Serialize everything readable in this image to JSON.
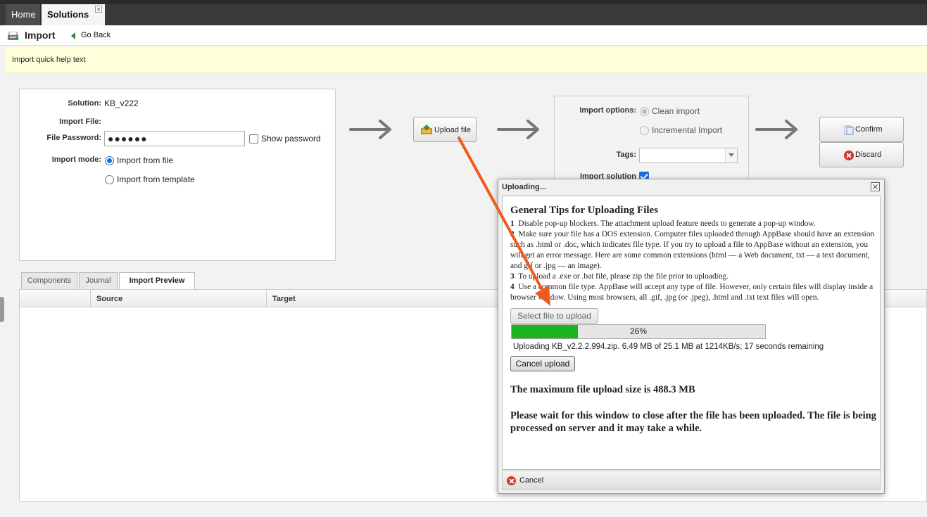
{
  "tabs": [
    {
      "label": "Home"
    },
    {
      "label": "Solutions"
    }
  ],
  "toolbar": {
    "title": "Import",
    "go_back_label": "Go Back"
  },
  "help_text": "Import quick help text",
  "form": {
    "solution_label": "Solution:",
    "solution_value": "KB_v222",
    "import_file_label": "Import File:",
    "file_password_label": "File Password:",
    "file_password_value": "●●●●●●",
    "show_password_label": "Show password",
    "import_mode_label": "Import mode:",
    "mode_file_label": "Import from file",
    "mode_template_label": "Import from template"
  },
  "upload_button_label": "Upload file",
  "options": {
    "import_options_label": "Import options:",
    "clean_import_label": "Clean import",
    "incremental_import_label": "Incremental Import",
    "tags_label": "Tags:",
    "import_solution_label": "Import solution"
  },
  "actions": {
    "confirm_label": "Confirm",
    "discard_label": "Discard"
  },
  "subtabs": [
    {
      "label": "Components"
    },
    {
      "label": "Journal"
    },
    {
      "label": "Import Preview"
    }
  ],
  "grid": {
    "columns": [
      "Source",
      "Target"
    ]
  },
  "dialog": {
    "title": "Uploading...",
    "tips_title": "General Tips for Uploading Files",
    "tips": [
      {
        "num": "1",
        "text": "Disable pop-up blockers. The attachment upload feature needs to generate a pop-up window."
      },
      {
        "num": "2",
        "text": "Make sure your file has a DOS extension. Computer files uploaded through AppBase should have an extension such as .html or .doc, which indicates file type. If you try to upload a file to AppBase without an extension, you will get an error message. Here are some common extensions (html — a Web document, txt — a text document, and gif or .jpg — an image)."
      },
      {
        "num": "3",
        "text": "To upload a .exe or .bat file, please zip the file prior to uploading."
      },
      {
        "num": "4",
        "text": "Use a common file type. AppBase will accept any type of file. However, only certain files will display inside a browser window. Using most browsers, all .gif, .jpg (or .jpeg), .html and .txt text files will open."
      }
    ],
    "select_file_label": "Select file to upload",
    "progress_percent": 26,
    "progress_label": "26%",
    "status_text": "Uploading KB_v2.2.2.994.zip. 6.49 MB of 25.1 MB at 1214KB/s; 17 seconds remaining",
    "cancel_upload_label": "Cancel upload",
    "max_size_text": "The maximum file upload size is 488.3 MB",
    "wait_text": "Please wait for this window to close after the file has been uploaded. The file is being processed on server and it may take a while.",
    "footer_cancel_label": "Cancel"
  },
  "colors": {
    "progress_fill": "#1db31d",
    "annotation_arrow": "#f05a1e",
    "help_bg": "#ffffdc"
  },
  "icons": [
    "tab-close-icon",
    "import-icon",
    "go-back-icon",
    "upload-icon",
    "confirm-icon",
    "discard-icon",
    "dialog-close-icon",
    "cancel-icon",
    "flow-arrow-icon",
    "annotation-arrow"
  ]
}
